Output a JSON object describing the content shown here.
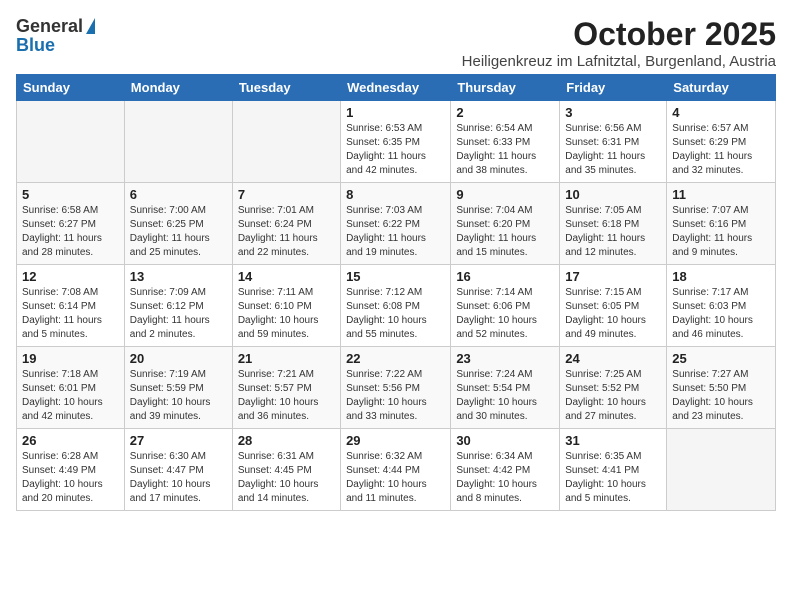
{
  "header": {
    "logo_general": "General",
    "logo_blue": "Blue",
    "title": "October 2025",
    "subtitle": "Heiligenkreuz im Lafnitztal, Burgenland, Austria"
  },
  "days_of_week": [
    "Sunday",
    "Monday",
    "Tuesday",
    "Wednesday",
    "Thursday",
    "Friday",
    "Saturday"
  ],
  "weeks": [
    [
      {
        "day": "",
        "info": ""
      },
      {
        "day": "",
        "info": ""
      },
      {
        "day": "",
        "info": ""
      },
      {
        "day": "1",
        "info": "Sunrise: 6:53 AM\nSunset: 6:35 PM\nDaylight: 11 hours and 42 minutes."
      },
      {
        "day": "2",
        "info": "Sunrise: 6:54 AM\nSunset: 6:33 PM\nDaylight: 11 hours and 38 minutes."
      },
      {
        "day": "3",
        "info": "Sunrise: 6:56 AM\nSunset: 6:31 PM\nDaylight: 11 hours and 35 minutes."
      },
      {
        "day": "4",
        "info": "Sunrise: 6:57 AM\nSunset: 6:29 PM\nDaylight: 11 hours and 32 minutes."
      }
    ],
    [
      {
        "day": "5",
        "info": "Sunrise: 6:58 AM\nSunset: 6:27 PM\nDaylight: 11 hours and 28 minutes."
      },
      {
        "day": "6",
        "info": "Sunrise: 7:00 AM\nSunset: 6:25 PM\nDaylight: 11 hours and 25 minutes."
      },
      {
        "day": "7",
        "info": "Sunrise: 7:01 AM\nSunset: 6:24 PM\nDaylight: 11 hours and 22 minutes."
      },
      {
        "day": "8",
        "info": "Sunrise: 7:03 AM\nSunset: 6:22 PM\nDaylight: 11 hours and 19 minutes."
      },
      {
        "day": "9",
        "info": "Sunrise: 7:04 AM\nSunset: 6:20 PM\nDaylight: 11 hours and 15 minutes."
      },
      {
        "day": "10",
        "info": "Sunrise: 7:05 AM\nSunset: 6:18 PM\nDaylight: 11 hours and 12 minutes."
      },
      {
        "day": "11",
        "info": "Sunrise: 7:07 AM\nSunset: 6:16 PM\nDaylight: 11 hours and 9 minutes."
      }
    ],
    [
      {
        "day": "12",
        "info": "Sunrise: 7:08 AM\nSunset: 6:14 PM\nDaylight: 11 hours and 5 minutes."
      },
      {
        "day": "13",
        "info": "Sunrise: 7:09 AM\nSunset: 6:12 PM\nDaylight: 11 hours and 2 minutes."
      },
      {
        "day": "14",
        "info": "Sunrise: 7:11 AM\nSunset: 6:10 PM\nDaylight: 10 hours and 59 minutes."
      },
      {
        "day": "15",
        "info": "Sunrise: 7:12 AM\nSunset: 6:08 PM\nDaylight: 10 hours and 55 minutes."
      },
      {
        "day": "16",
        "info": "Sunrise: 7:14 AM\nSunset: 6:06 PM\nDaylight: 10 hours and 52 minutes."
      },
      {
        "day": "17",
        "info": "Sunrise: 7:15 AM\nSunset: 6:05 PM\nDaylight: 10 hours and 49 minutes."
      },
      {
        "day": "18",
        "info": "Sunrise: 7:17 AM\nSunset: 6:03 PM\nDaylight: 10 hours and 46 minutes."
      }
    ],
    [
      {
        "day": "19",
        "info": "Sunrise: 7:18 AM\nSunset: 6:01 PM\nDaylight: 10 hours and 42 minutes."
      },
      {
        "day": "20",
        "info": "Sunrise: 7:19 AM\nSunset: 5:59 PM\nDaylight: 10 hours and 39 minutes."
      },
      {
        "day": "21",
        "info": "Sunrise: 7:21 AM\nSunset: 5:57 PM\nDaylight: 10 hours and 36 minutes."
      },
      {
        "day": "22",
        "info": "Sunrise: 7:22 AM\nSunset: 5:56 PM\nDaylight: 10 hours and 33 minutes."
      },
      {
        "day": "23",
        "info": "Sunrise: 7:24 AM\nSunset: 5:54 PM\nDaylight: 10 hours and 30 minutes."
      },
      {
        "day": "24",
        "info": "Sunrise: 7:25 AM\nSunset: 5:52 PM\nDaylight: 10 hours and 27 minutes."
      },
      {
        "day": "25",
        "info": "Sunrise: 7:27 AM\nSunset: 5:50 PM\nDaylight: 10 hours and 23 minutes."
      }
    ],
    [
      {
        "day": "26",
        "info": "Sunrise: 6:28 AM\nSunset: 4:49 PM\nDaylight: 10 hours and 20 minutes."
      },
      {
        "day": "27",
        "info": "Sunrise: 6:30 AM\nSunset: 4:47 PM\nDaylight: 10 hours and 17 minutes."
      },
      {
        "day": "28",
        "info": "Sunrise: 6:31 AM\nSunset: 4:45 PM\nDaylight: 10 hours and 14 minutes."
      },
      {
        "day": "29",
        "info": "Sunrise: 6:32 AM\nSunset: 4:44 PM\nDaylight: 10 hours and 11 minutes."
      },
      {
        "day": "30",
        "info": "Sunrise: 6:34 AM\nSunset: 4:42 PM\nDaylight: 10 hours and 8 minutes."
      },
      {
        "day": "31",
        "info": "Sunrise: 6:35 AM\nSunset: 4:41 PM\nDaylight: 10 hours and 5 minutes."
      },
      {
        "day": "",
        "info": ""
      }
    ]
  ]
}
